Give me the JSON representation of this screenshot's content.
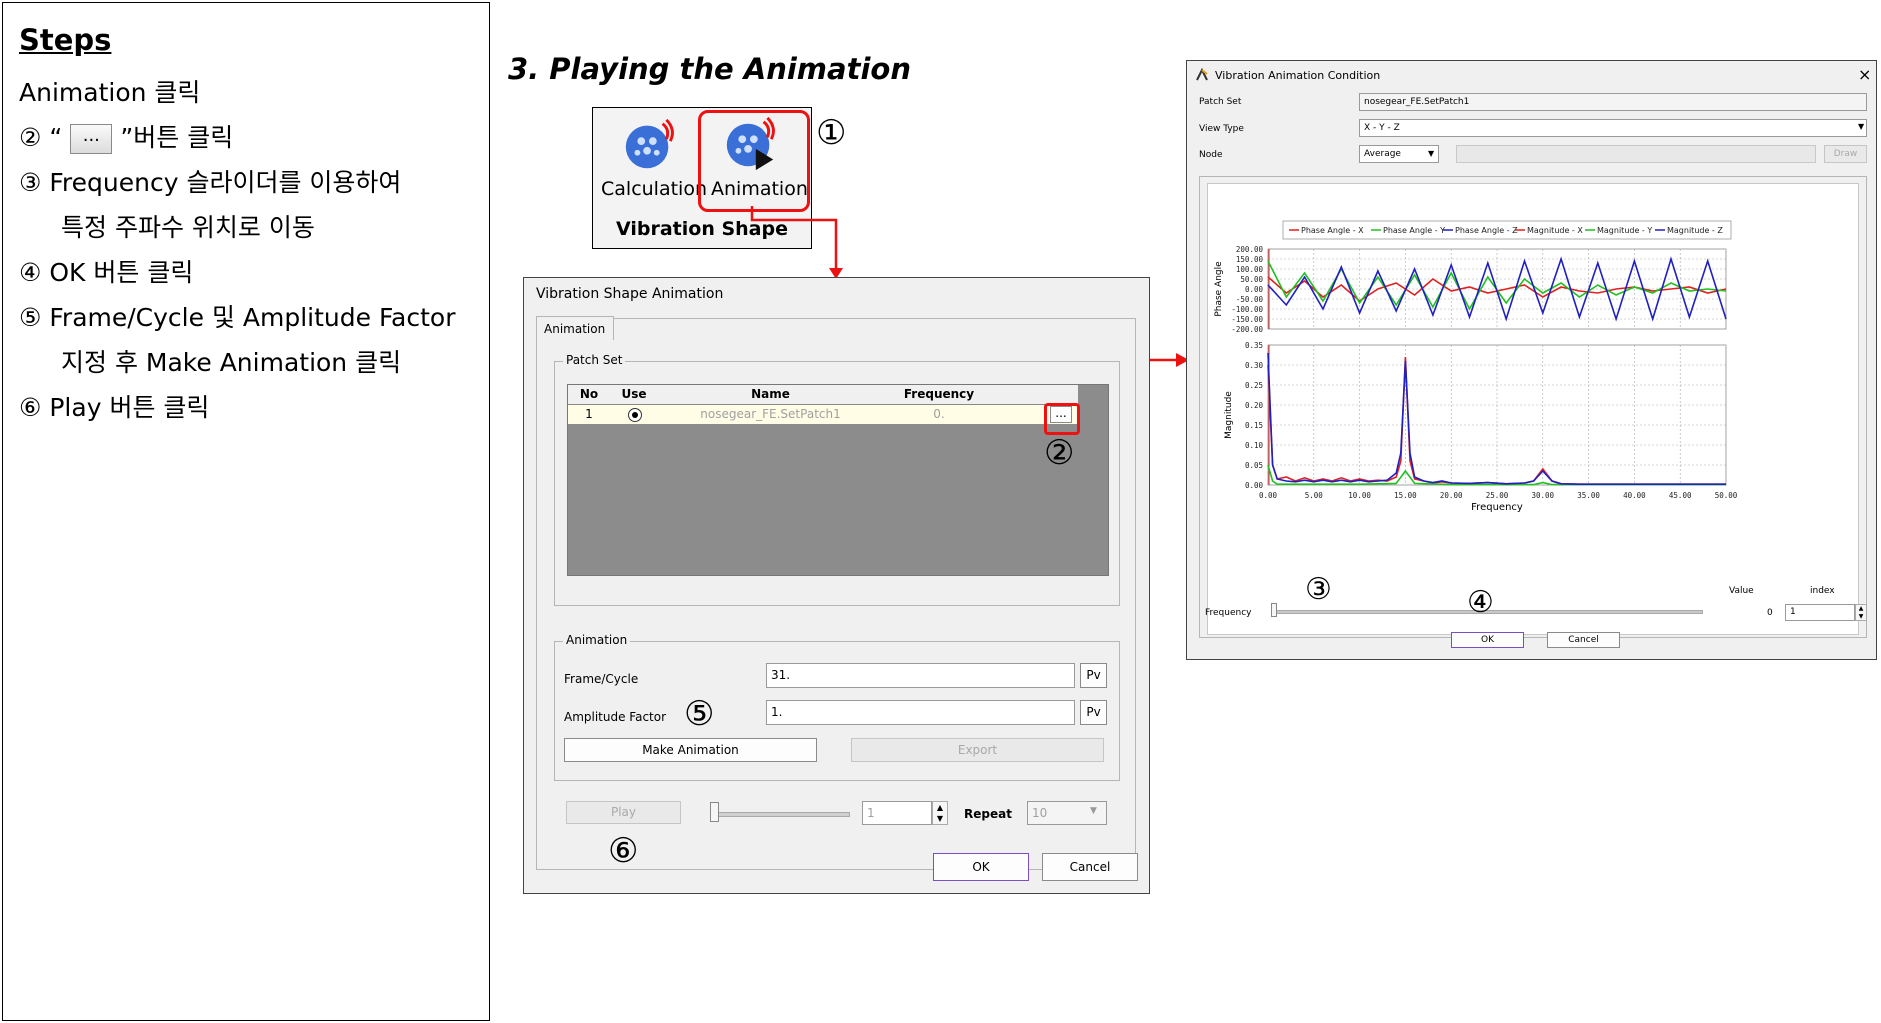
{
  "steps": {
    "title": "Steps",
    "lines": [
      "Animation 클릭",
      "②  “",
      "”버튼 클릭",
      "③ Frequency 슬라이더를 이용하여",
      "특정 주파수 위치로 이동",
      "④ OK 버튼 클릭",
      "⑤ Frame/Cycle 및 Amplitude Factor",
      "지정 후 Make Animation 클릭",
      "⑥ Play 버튼 클릭"
    ],
    "dots_label": "..."
  },
  "heading": "3. Playing the Animation",
  "ribbon": {
    "calc_label": "Calculation",
    "anim_label": "Animation",
    "group_label": "Vibration Shape"
  },
  "callouts": {
    "c1": "①",
    "c2": "②",
    "c3": "③",
    "c4": "④",
    "c5": "⑤",
    "c6": "⑥"
  },
  "anim_dialog": {
    "title": "Vibration Shape Animation",
    "tab": "Animation",
    "patch_set_group": "Patch Set",
    "columns": [
      "No",
      "Use",
      "Name",
      "Frequency"
    ],
    "row": {
      "no": "1",
      "name": "nosegear_FE.SetPatch1",
      "frequency": "0."
    },
    "dots_button": "...",
    "animation_group": "Animation",
    "frame_cycle_label": "Frame/Cycle",
    "frame_cycle_value": "31.",
    "amplitude_label": "Amplitude Factor",
    "amplitude_value": "1.",
    "pv": "Pv",
    "make_animation": "Make Animation",
    "export": "Export",
    "play": "Play",
    "frame_value": "1",
    "repeat_label": "Repeat",
    "repeat_value": "10",
    "ok": "OK",
    "cancel": "Cancel"
  },
  "cond_dialog": {
    "title": "Vibration Animation Condition",
    "close": "×",
    "patch_set_label": "Patch Set",
    "patch_set_value": "nosegear_FE.SetPatch1",
    "view_type_label": "View Type",
    "view_type_value": "X - Y - Z",
    "node_label": "Node",
    "node_value": "Average",
    "draw": "Draw",
    "frequency_label": "Frequency",
    "value_label": "Value",
    "index_label": "index",
    "value": "0",
    "index_value": "1",
    "ok": "OK",
    "cancel": "Cancel"
  },
  "chart_data": [
    {
      "type": "line",
      "ylabel": "Phase Angle",
      "ylim": [
        -200,
        200
      ],
      "yticks": [
        "200.00",
        "150.00",
        "100.00",
        "50.00",
        "0.00",
        "-50.00",
        "-100.00",
        "-150.00",
        "-200.00"
      ],
      "legend": [
        "Phase Angle - X",
        "Phase Angle - Y",
        "Phase Angle - Z",
        "Magnitude - X",
        "Magnitude - Y",
        "Magnitude - Z"
      ],
      "legend_colors": [
        "#e02020",
        "#20c020",
        "#2020c0",
        "#e02020",
        "#20c020",
        "#2020c0"
      ],
      "xlim": [
        0,
        50
      ],
      "grid": true,
      "series": [
        {
          "name": "Phase Angle - X",
          "color": "#e02020",
          "x": [
            0,
            2,
            4,
            6,
            8,
            10,
            12,
            14,
            16,
            18,
            20,
            22,
            24,
            26,
            28,
            30,
            32,
            34,
            36,
            38,
            40,
            42,
            44,
            46,
            48,
            50
          ],
          "values": [
            60,
            -20,
            40,
            -40,
            20,
            -60,
            0,
            30,
            -30,
            50,
            -10,
            10,
            -20,
            0,
            20,
            -40,
            10,
            -10,
            -20,
            0,
            10,
            -10,
            0,
            10,
            -20,
            0
          ]
        },
        {
          "name": "Phase Angle - Y",
          "color": "#20c020",
          "x": [
            0,
            2,
            4,
            6,
            8,
            10,
            12,
            14,
            16,
            18,
            20,
            22,
            24,
            26,
            28,
            30,
            32,
            34,
            36,
            38,
            40,
            42,
            44,
            46,
            48,
            50
          ],
          "values": [
            140,
            -40,
            80,
            -60,
            100,
            -70,
            60,
            -80,
            70,
            -90,
            80,
            -100,
            60,
            -70,
            50,
            -20,
            30,
            -40,
            20,
            -30,
            10,
            -20,
            30,
            -10,
            0,
            -10
          ]
        },
        {
          "name": "Phase Angle - Z",
          "color": "#2020c0",
          "x": [
            0,
            2,
            4,
            6,
            8,
            10,
            12,
            14,
            16,
            18,
            20,
            22,
            24,
            26,
            28,
            30,
            32,
            34,
            36,
            38,
            40,
            42,
            44,
            46,
            48,
            50
          ],
          "values": [
            20,
            -80,
            60,
            -100,
            110,
            -120,
            90,
            -110,
            100,
            -130,
            120,
            -140,
            130,
            -150,
            140,
            -120,
            150,
            -140,
            130,
            -150,
            140,
            -150,
            150,
            -140,
            140,
            -150
          ]
        }
      ]
    },
    {
      "type": "line",
      "ylabel": "Magnitude",
      "xlabel": "Frequency",
      "ylim": [
        0,
        0.35
      ],
      "xlim": [
        0,
        50
      ],
      "yticks": [
        "0.35",
        "0.30",
        "0.25",
        "0.20",
        "0.15",
        "0.10",
        "0.05",
        "0.00"
      ],
      "xticks": [
        "0.00",
        "5.00",
        "10.00",
        "15.00",
        "20.00",
        "25.00",
        "30.00",
        "35.00",
        "40.00",
        "45.00",
        "50.00"
      ],
      "grid": true,
      "series": [
        {
          "name": "Magnitude - X",
          "color": "#e02020",
          "x": [
            0,
            0.5,
            1,
            2,
            3,
            4,
            5,
            6,
            7,
            8,
            9,
            10,
            11,
            12,
            13,
            14,
            14.5,
            15,
            15.5,
            16,
            17,
            18,
            19,
            20,
            22,
            24,
            26,
            28,
            29,
            30,
            31,
            32,
            34,
            36,
            40,
            45,
            50
          ],
          "values": [
            0.3,
            0.05,
            0.015,
            0.02,
            0.01,
            0.018,
            0.01,
            0.015,
            0.01,
            0.018,
            0.01,
            0.015,
            0.01,
            0.012,
            0.01,
            0.02,
            0.06,
            0.32,
            0.06,
            0.015,
            0.01,
            0.005,
            0.008,
            0.005,
            0.004,
            0.006,
            0.003,
            0.005,
            0.01,
            0.04,
            0.01,
            0.003,
            0.002,
            0.002,
            0.002,
            0.002,
            0.002
          ]
        },
        {
          "name": "Magnitude - Y",
          "color": "#20c020",
          "x": [
            0,
            0.5,
            1,
            2,
            5,
            10,
            14,
            15,
            16,
            20,
            29,
            30,
            31,
            35,
            40,
            45,
            50
          ],
          "values": [
            0.05,
            0.01,
            0.002,
            0.002,
            0.002,
            0.002,
            0.004,
            0.035,
            0.004,
            0.001,
            0.001,
            0.006,
            0.001,
            0.001,
            0.001,
            0.001,
            0.001
          ]
        },
        {
          "name": "Magnitude - Z",
          "color": "#2020c0",
          "x": [
            0,
            0.5,
            1,
            2,
            3,
            4,
            5,
            6,
            7,
            8,
            9,
            10,
            11,
            12,
            13,
            14,
            14.5,
            15,
            15.5,
            16,
            17,
            18,
            19,
            20,
            22,
            24,
            26,
            28,
            29,
            30,
            31,
            32,
            34,
            36,
            40,
            45,
            50
          ],
          "values": [
            0.33,
            0.05,
            0.015,
            0.01,
            0.008,
            0.012,
            0.008,
            0.012,
            0.008,
            0.012,
            0.008,
            0.012,
            0.008,
            0.01,
            0.012,
            0.03,
            0.08,
            0.31,
            0.08,
            0.02,
            0.01,
            0.006,
            0.01,
            0.005,
            0.004,
            0.006,
            0.003,
            0.005,
            0.01,
            0.035,
            0.01,
            0.003,
            0.002,
            0.002,
            0.002,
            0.002,
            0.002
          ]
        }
      ]
    }
  ]
}
